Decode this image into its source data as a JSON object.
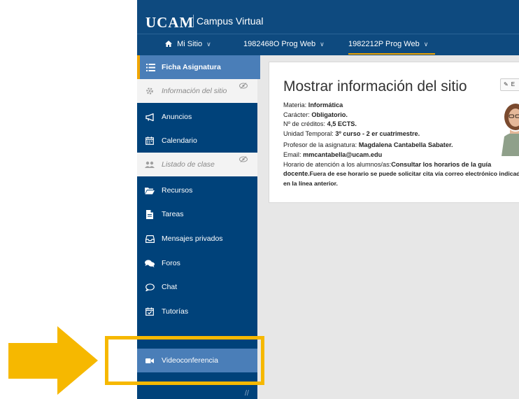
{
  "header": {
    "brand": "UCAM",
    "brand_sub": "Campus Virtual"
  },
  "tabs": [
    {
      "label": "Mi Sitio",
      "icon": "home-icon"
    },
    {
      "label": "1982468O Prog Web"
    },
    {
      "label": "1982212P Prog Web",
      "active": true
    }
  ],
  "sidebar": {
    "items": [
      {
        "label": "Ficha Asignatura",
        "icon": "list-icon",
        "state": "header"
      },
      {
        "label": "Información del sitio",
        "icon": "gear-icon",
        "state": "hidden"
      },
      {
        "label": "Anuncios",
        "icon": "megaphone-icon"
      },
      {
        "label": "Calendario",
        "icon": "calendar-icon"
      },
      {
        "label": "Listado de clase",
        "icon": "users-icon",
        "state": "hidden"
      },
      {
        "label": "Recursos",
        "icon": "folder-icon"
      },
      {
        "label": "Tareas",
        "icon": "file-icon"
      },
      {
        "label": "Mensajes privados",
        "icon": "inbox-icon"
      },
      {
        "label": "Foros",
        "icon": "comments-icon"
      },
      {
        "label": "Chat",
        "icon": "chat-icon"
      },
      {
        "label": "Tutorías",
        "icon": "calendar-check-icon"
      },
      {
        "label": "Videoconferencia",
        "icon": "video-camera-icon",
        "state": "highlighted"
      }
    ]
  },
  "main": {
    "title": "Mostrar información del sitio",
    "edit_label": "E",
    "materia_label": "Materia:",
    "materia_value": "Informática",
    "caracter_label": "Carácter:",
    "caracter_value": "Obligatorio.",
    "creditos_label": "Nº de créditos:",
    "creditos_value": "4,5 ECTS.",
    "unidad_label": "Unidad Temporal:",
    "unidad_value": "3º curso - 2 er cuatrimestre.",
    "profesor_label": "Profesor de la asignatura:",
    "profesor_value": "Magdalena Cantabella Sabater.",
    "email_label": "Email:",
    "email_value": "mmcantabella@ucam.edu",
    "horario_label": "Horario de atención a los alumnos/as:",
    "horario_value": "Consultar los horarios de la guía docente",
    "horario_extra": ".Fuera de ese horario se puede solicitar cita vía correo electrónico indicado en la línea anterior."
  },
  "annotation": {
    "arrow_color": "#f6b800",
    "highlight_color": "#f6b800"
  }
}
